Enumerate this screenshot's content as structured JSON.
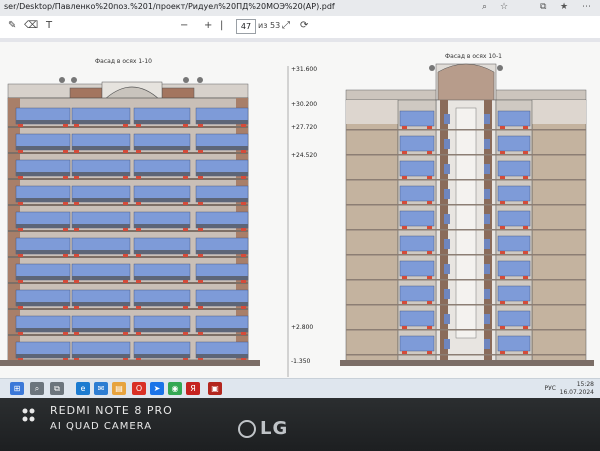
{
  "browser": {
    "url": "ser/Desktop/Павленко%20поз.%201/проект/Ридуел%20ПД%20МОЭ%20(АР).pdf"
  },
  "pdf_toolbar": {
    "page_current": "47",
    "page_total": "из 53",
    "zoom_minus": "−",
    "zoom_plus": "+"
  },
  "drawing": {
    "left_title": "Фасад в осях 1-10",
    "right_title": "Фасад в осях 10-1",
    "elevations": [
      "+31.600",
      "+30.200",
      "+27.720",
      "+24.520",
      "+2.800",
      "-1.350"
    ]
  },
  "taskbar": {
    "lang": "РУС",
    "time": "15:28",
    "date": "16.07.2024"
  },
  "photo_watermark": {
    "line1": "REDMI NOTE 8 PRO",
    "line2": "AI QUAD CAMERA"
  },
  "monitor": {
    "brand": "LG"
  }
}
